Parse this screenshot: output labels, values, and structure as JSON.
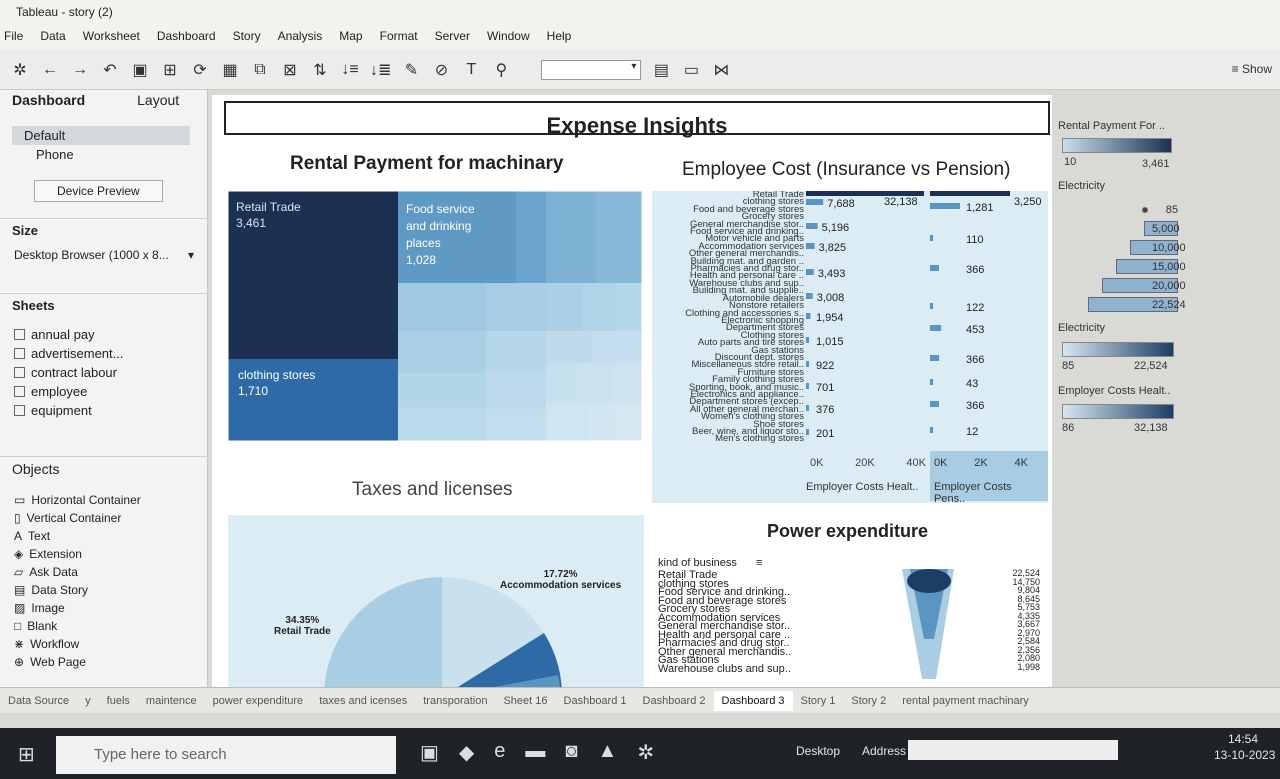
{
  "window": {
    "title": "Tableau - story (2)"
  },
  "menu": [
    "File",
    "Data",
    "Worksheet",
    "Dashboard",
    "Story",
    "Analysis",
    "Map",
    "Format",
    "Server",
    "Window",
    "Help"
  ],
  "toolbar": {
    "show_label": "Show"
  },
  "left_pane": {
    "tabs": [
      "Dashboard",
      "Layout"
    ],
    "devices": [
      "Default",
      "Phone"
    ],
    "device_preview_button": "Device Preview",
    "size_header": "Size",
    "size_value": "Desktop Browser (1000 x 8...",
    "sheets_header": "Sheets",
    "sheets": [
      "annual pay",
      "advertisement...",
      "contract labour",
      "employee",
      "equipment"
    ],
    "objects_header": "Objects",
    "objects": [
      "Horizontal Container",
      "Vertical Container",
      "Text",
      "Extension",
      "Ask Data",
      "Data Story",
      "Image",
      "Blank",
      "Workflow",
      "Web Page"
    ]
  },
  "dashboard": {
    "title": "Expense Insights",
    "treemap_title": "Rental Payment for machinary",
    "treemap": {
      "cells": [
        {
          "label": "Retail Trade",
          "value": "3,461"
        },
        {
          "label": "Food service and drinking places",
          "value": "1,028"
        },
        {
          "label": "clothing stores",
          "value": "1,710"
        }
      ]
    },
    "employee_cost_title": "Employee Cost (Insurance vs Pension)",
    "employee_cost": {
      "categories": [
        "Retail Trade",
        "clothing stores",
        "Food and beverage stores",
        "Grocery stores",
        "General merchandise stor..",
        "Food service and drinking..",
        "Motor vehicle and parts",
        "Accommodation services",
        "Other general merchandis..",
        "Building mat. and garden ..",
        "Pharmacies and drug stor..",
        "Health and personal care ..",
        "Warehouse clubs and sup..",
        "Building mat. and supplie..",
        "Automobile dealers",
        "Nonstore retailers",
        "Clothing and accessories s..",
        "Electronic shopping",
        "Department stores",
        "Clothing stores",
        "Auto parts and tire stores",
        "Gas stations",
        "Discount dept. stores",
        "Miscellaneous store retail..",
        "Furniture stores",
        "Family clothing stores",
        "Sporting, book, and music..",
        "Electronics and appliance..",
        "Department stores (excep..",
        "All other general merchan..",
        "Women's clothing stores",
        "Shoe stores",
        "Beer, wine, and liquor sto..",
        "Men's clothing stores"
      ],
      "insurance_labels": [
        "32,138",
        "7,688",
        "5,196",
        "3,825",
        "3,493",
        "3,008",
        "1,954",
        "1,015",
        "922",
        "701",
        "376",
        "201"
      ],
      "pension_labels": [
        "3,250",
        "1,281",
        "110",
        "366",
        "122",
        "453",
        "366",
        "43",
        "366",
        "12"
      ],
      "insurance_ticks": [
        "0K",
        "20K",
        "40K"
      ],
      "pension_ticks": [
        "0K",
        "2K",
        "4K"
      ],
      "insurance_axis": "Employer Costs Healt..",
      "pension_axis": "Employer Costs Pens.."
    },
    "taxes_title": "Taxes and licenses",
    "taxes": [
      {
        "pct": "17.72%",
        "label": "Accommodation services"
      },
      {
        "pct": "34.35%",
        "label": "Retail Trade"
      }
    ],
    "power_title": "Power expenditure",
    "power": {
      "header": "kind of business",
      "rows": [
        "Retail Trade",
        "clothing stores",
        "Food service and drinking..",
        "Food and beverage stores",
        "Grocery stores",
        "Accommodation services",
        "General merchandise stor..",
        "Health and personal care ..",
        "Pharmacies and drug stor..",
        "Other general merchandis..",
        "Gas stations",
        "Warehouse clubs and sup.."
      ],
      "values": [
        "22,524",
        "14,750",
        "9,804",
        "8,645",
        "5,753",
        "4,335",
        "3,667",
        "2,970",
        "2,584",
        "2,356",
        "2,080",
        "1,998"
      ]
    }
  },
  "legends": {
    "rental": {
      "title": "Rental Payment For ..",
      "min": "10",
      "max": "3,461"
    },
    "electricity_size": {
      "title": "Electricity",
      "values": [
        "85",
        "5,000",
        "10,000",
        "15,000",
        "20,000",
        "22,524"
      ]
    },
    "electricity_color": {
      "title": "Electricity",
      "min": "85",
      "max": "22,524"
    },
    "employer": {
      "title": "Employer Costs Healt..",
      "min": "86",
      "max": "32,138"
    }
  },
  "sheet_tabs": [
    "Data Source",
    "y",
    "fuels",
    "maintence",
    "power expenditure",
    "taxes and icenses",
    "transporation",
    "Sheet 16",
    "Dashboard 1",
    "Dashboard 2",
    "Dashboard 3",
    "Story 1",
    "Story 2",
    "rental payment machinary"
  ],
  "active_tab": "Dashboard 3",
  "taskbar": {
    "search_placeholder": "Type here to search",
    "desktop": "Desktop",
    "address": "Address",
    "time": "14:54",
    "date": "13-10-2023"
  },
  "colors": {
    "dark_navy": "#1c3152",
    "mid_blue": "#2e6aa5",
    "light_blue": "#b9d7e8",
    "pale_blue": "#dcecf5"
  }
}
